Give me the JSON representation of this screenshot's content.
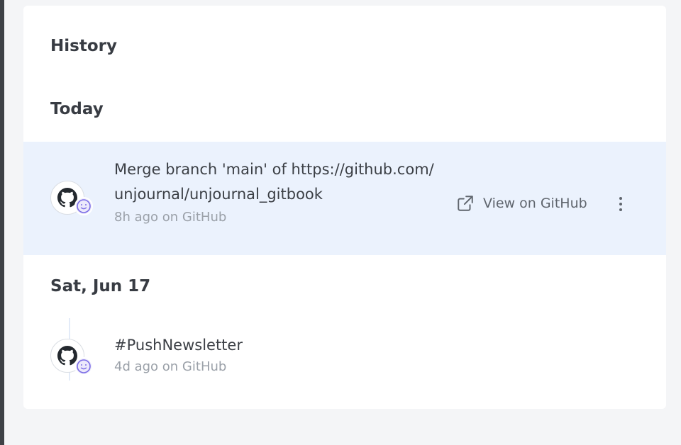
{
  "history": {
    "title": "History",
    "groups": [
      {
        "date": "Today",
        "entries": [
          {
            "message": "Merge branch 'main' of https://github.com/unjournal/unjournal_gitbook",
            "meta": "8h ago on GitHub",
            "action_label": "View on GitHub",
            "source_icon": "github-icon",
            "badge_icon": "smiley-icon"
          }
        ]
      },
      {
        "date": "Sat, Jun 17",
        "entries": [
          {
            "message": "#PushNewsletter",
            "meta": "4d ago on GitHub",
            "source_icon": "github-icon",
            "badge_icon": "smiley-icon"
          }
        ]
      }
    ]
  },
  "colors": {
    "highlight_row": "#ebf2fd",
    "badge_accent": "#7c6ee6",
    "muted_text": "#9aa0a8"
  }
}
